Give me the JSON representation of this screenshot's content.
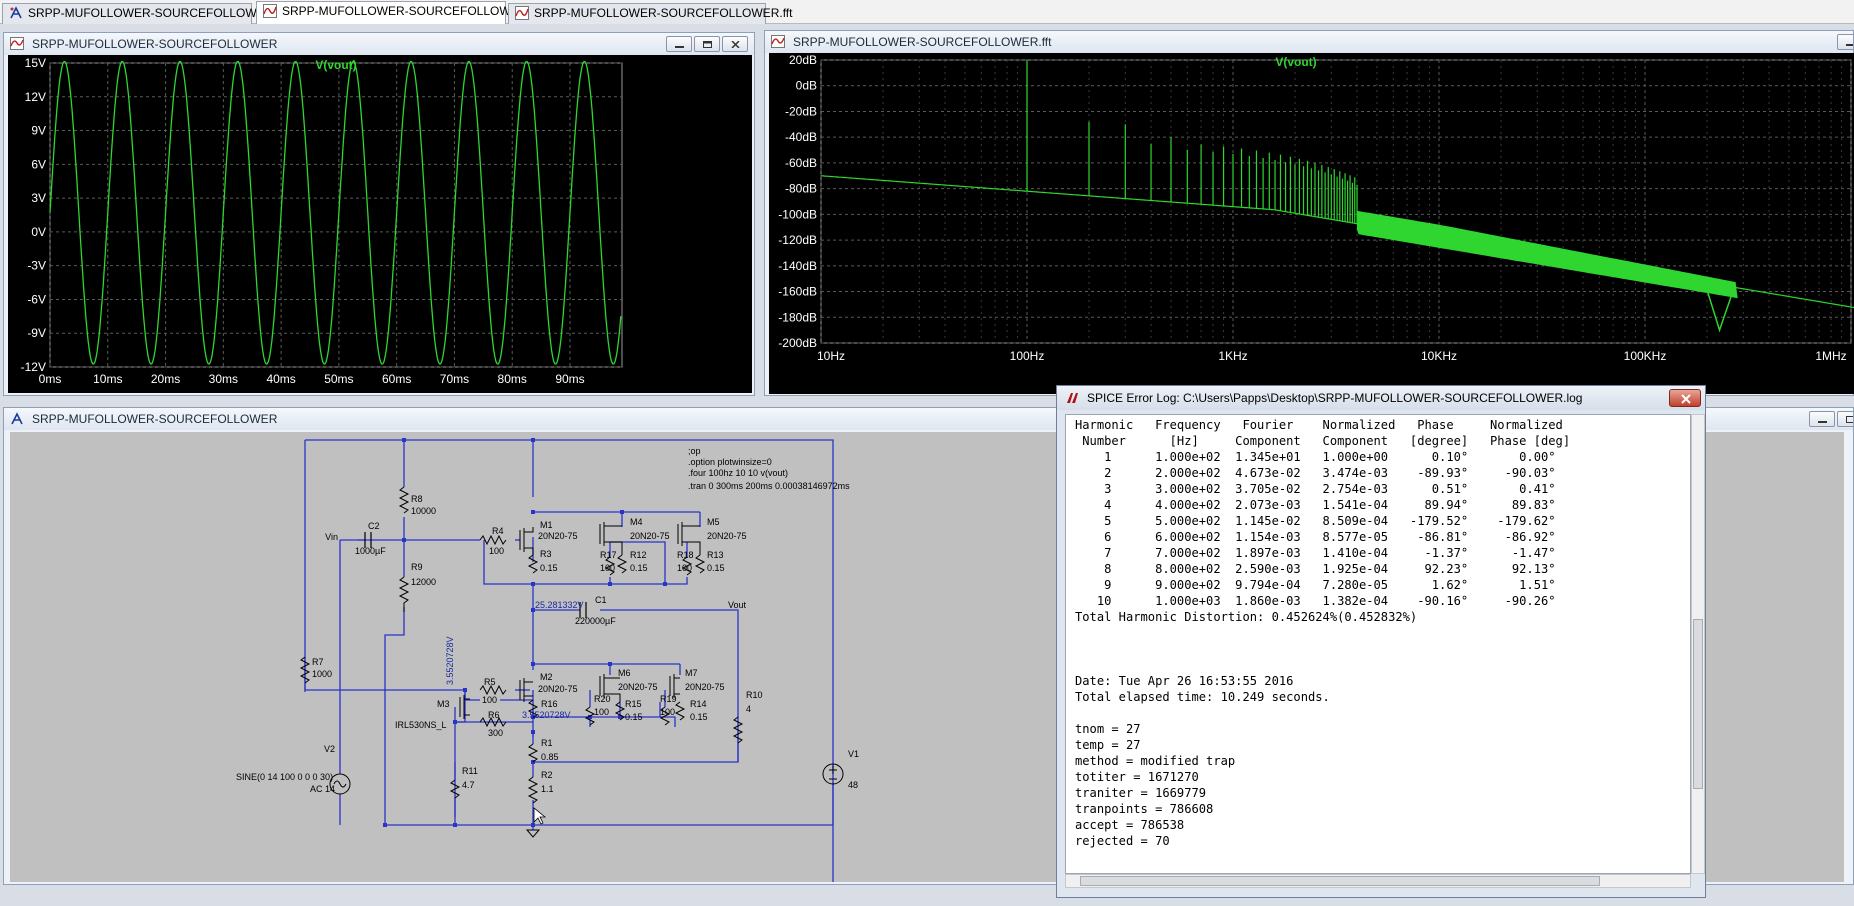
{
  "tabs": [
    {
      "label": "SRPP-MUFOLLOWER-SOURCEFOLLOWER",
      "icon": "schematic-icon",
      "active": false
    },
    {
      "label": "SRPP-MUFOLLOWER-SOURCEFOLLOWER",
      "icon": "waveform-icon",
      "active": true
    },
    {
      "label": "SRPP-MUFOLLOWER-SOURCEFOLLOWER.fft",
      "icon": "waveform-icon",
      "active": false
    }
  ],
  "windows": {
    "transient": {
      "title": "SRPP-MUFOLLOWER-SOURCEFOLLOWER"
    },
    "fft": {
      "title": "SRPP-MUFOLLOWER-SOURCEFOLLOWER.fft"
    },
    "schematic": {
      "title": "SRPP-MUFOLLOWER-SOURCEFOLLOWER"
    },
    "log": {
      "title": "SPICE Error Log: C:\\Users\\Papps\\Desktop\\SRPP-MUFOLLOWER-SOURCEFOLLOWER.log"
    }
  },
  "colors": {
    "trace": "#2fd62f",
    "grid": "#5a5a5a",
    "plot_bg": "#000000",
    "axis_text": "#ffffff",
    "wire": "#2a34c8",
    "schematic_bg": "#c0c0c0"
  },
  "chart_data": [
    {
      "type": "line",
      "series": [
        {
          "name": "V(vout)",
          "function": "sine",
          "amplitude_v": 13.45,
          "offset_v": 1.7,
          "frequency_hz": 100,
          "phase_deg": 0.1
        }
      ],
      "x_range_ms": [
        0,
        99
      ],
      "x_ticks": [
        "0ms",
        "10ms",
        "20ms",
        "30ms",
        "40ms",
        "50ms",
        "60ms",
        "70ms",
        "80ms",
        "90ms"
      ],
      "y_ticks": [
        "15V",
        "12V",
        "9V",
        "6V",
        "3V",
        "0V",
        "-3V",
        "-6V",
        "-9V",
        "-12V"
      ],
      "ylim": [
        -12,
        15
      ],
      "grid": true
    },
    {
      "type": "line",
      "series": [
        {
          "name": "V(vout)"
        }
      ],
      "x_scale": "log",
      "x_ticks": [
        "10Hz",
        "100Hz",
        "1KHz",
        "10KHz",
        "100KHz",
        "1MHz"
      ],
      "y_ticks": [
        "20dB",
        "0dB",
        "-20dB",
        "-40dB",
        "-60dB",
        "-80dB",
        "-100dB",
        "-120dB",
        "-140dB",
        "-160dB",
        "-180dB",
        "-200dB"
      ],
      "ylim": [
        -200,
        20
      ],
      "grid": true
    }
  ],
  "schematic": {
    "directives": [
      ";op",
      ".option plotwinsize=0",
      ".four 100hz 10 10 v(vout)",
      ".tran 0 300ms 200ms 0.00038146972ms"
    ],
    "labels": {
      "vin": "Vin",
      "vout": "Vout",
      "c2": "C2",
      "c2v": "1000µF",
      "c1": "C1",
      "c1v": "220000µF",
      "r8": "R8",
      "r8v": "10000",
      "r9": "R9",
      "r9v": "12000",
      "r7": "R7",
      "r7v": "1000",
      "r4": "R4",
      "r4v": "100",
      "r3": "R3",
      "r3v": "0.15",
      "r17": "R17",
      "r17v": "100",
      "r12": "R12",
      "r12v": "0.15",
      "r18": "R18",
      "r18v": "100",
      "r13": "R13",
      "r13v": "0.15",
      "m1": "M1",
      "m1v": "20N20-75",
      "m4": "M4",
      "m4v": "20N20-75",
      "m5": "M5",
      "m5v": "20N20-75",
      "m2": "M2",
      "m2v": "20N20-75",
      "m6": "M6",
      "m6v": "20N20-75",
      "m7": "M7",
      "m7v": "20N20-75",
      "m3": "M3",
      "m3v": "IRL530NS_L",
      "r5": "R5",
      "r5v": "100",
      "r6": "R6",
      "r6v": "300",
      "r16": "R16",
      "r20": "R20",
      "r20v": "100",
      "r15": "R15",
      "r15v": "0.15",
      "r19": "R19",
      "r19v": "100",
      "r14": "R14",
      "r14v": "0.15",
      "r10": "R10",
      "r10v": "4",
      "r1": "R1",
      "r1v": "0.85",
      "r2": "R2",
      "r2v": "1.1",
      "r11": "R11",
      "r11v": "4.7",
      "v1": "V1",
      "v1v": "48",
      "v2": "V2",
      "v2v": "SINE(0 14 100 0 0 0 30)",
      "v2ac": "AC 14",
      "volt1": "25.281332V",
      "volt2": "3.5520728V",
      "volt3": "3.5520728V"
    }
  },
  "log_lines": [
    "Harmonic   Frequency   Fourier    Normalized   Phase     Normalized",
    " Number      [Hz]     Component   Component   [degree]   Phase [deg]",
    "    1      1.000e+02  1.345e+01   1.000e+00      0.10°       0.00°",
    "    2      2.000e+02  4.673e-02   3.474e-03    -89.93°     -90.03°",
    "    3      3.000e+02  3.705e-02   2.754e-03      0.51°       0.41°",
    "    4      4.000e+02  2.073e-03   1.541e-04     89.94°      89.83°",
    "    5      5.000e+02  1.145e-02   8.509e-04   -179.52°    -179.62°",
    "    6      6.000e+02  1.154e-03   8.577e-05    -86.81°     -86.92°",
    "    7      7.000e+02  1.897e-03   1.410e-04     -1.37°      -1.47°",
    "    8      8.000e+02  2.590e-03   1.925e-04     92.23°      92.13°",
    "    9      9.000e+02  9.794e-04   7.280e-05      1.62°       1.51°",
    "   10      1.000e+03  1.860e-03   1.382e-04    -90.16°     -90.26°",
    "Total Harmonic Distortion: 0.452624%(0.452832%)",
    "",
    "",
    "",
    "Date: Tue Apr 26 16:53:55 2016",
    "Total elapsed time: 10.249 seconds.",
    "",
    "tnom = 27",
    "temp = 27",
    "method = modified trap",
    "totiter = 1671270",
    "traniter = 1669779",
    "tranpoints = 786608",
    "accept = 786538",
    "rejected = 70"
  ]
}
